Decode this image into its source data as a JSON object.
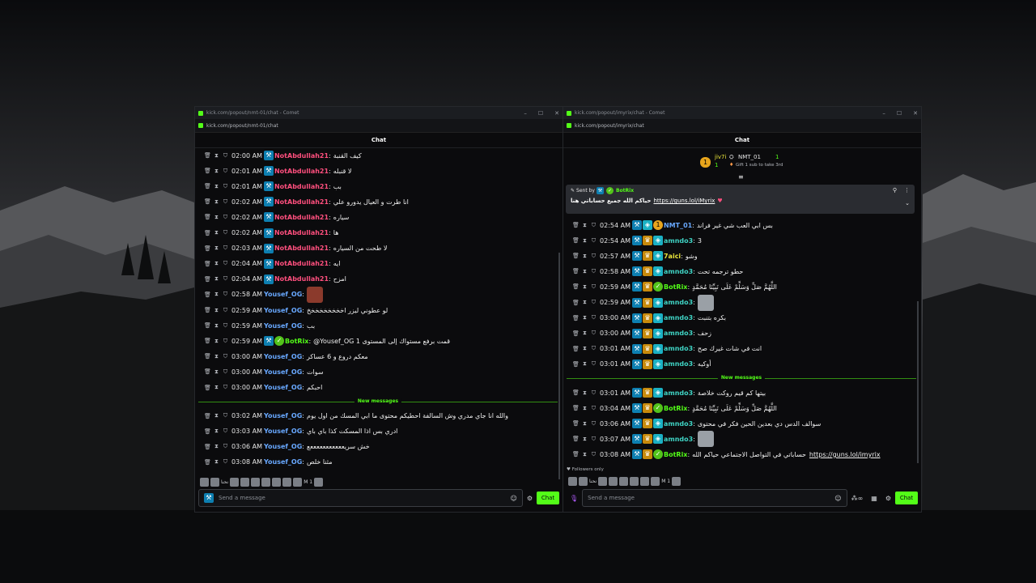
{
  "left_window": {
    "tab_url": "kick.com/popout/nmt-01/chat - Comet",
    "address": "kick.com/popout/nmt-01/chat",
    "header": "Chat",
    "messages": [
      {
        "time": "02:00 AM",
        "user": "NotAbdullah21",
        "color": "pink",
        "badges": [
          "mod"
        ],
        "text": "كيف القنبة"
      },
      {
        "time": "02:01 AM",
        "user": "NotAbdullah21",
        "color": "pink",
        "badges": [
          "mod"
        ],
        "text": "لا قنبله"
      },
      {
        "time": "02:01 AM",
        "user": "NotAbdullah21",
        "color": "pink",
        "badges": [
          "mod"
        ],
        "text": "بب"
      },
      {
        "time": "02:02 AM",
        "user": "NotAbdullah21",
        "color": "pink",
        "badges": [
          "mod"
        ],
        "text": "انا طرت و العيال يدورو علي"
      },
      {
        "time": "02:02 AM",
        "user": "NotAbdullah21",
        "color": "pink",
        "badges": [
          "mod"
        ],
        "text": "سياره"
      },
      {
        "time": "02:02 AM",
        "user": "NotAbdullah21",
        "color": "pink",
        "badges": [
          "mod"
        ],
        "text": "ها"
      },
      {
        "time": "02:03 AM",
        "user": "NotAbdullah21",
        "color": "pink",
        "badges": [
          "mod"
        ],
        "text": "لا طحت من السياره"
      },
      {
        "time": "02:04 AM",
        "user": "NotAbdullah21",
        "color": "pink",
        "badges": [
          "mod"
        ],
        "text": "ايه"
      },
      {
        "time": "02:04 AM",
        "user": "NotAbdullah21",
        "color": "pink",
        "badges": [
          "mod"
        ],
        "text": "امزح"
      },
      {
        "time": "02:58 AM",
        "user": "Yousef_OG",
        "color": "blue",
        "badges": [],
        "text": "",
        "emote": true
      },
      {
        "time": "02:59 AM",
        "user": "Yousef_OG",
        "color": "blue",
        "badges": [],
        "text": "لو عطوني ليزر اخخخخخخخخخ"
      },
      {
        "time": "02:59 AM",
        "user": "Yousef_OG",
        "color": "blue",
        "badges": [],
        "text": "بب"
      },
      {
        "time": "02:59 AM",
        "user": "BotRix",
        "color": "green",
        "badges": [
          "mod",
          "verify"
        ],
        "text": "@Yousef_OG 1 قمت برفع مستواك إلى المستوى"
      },
      {
        "time": "03:00 AM",
        "user": "Yousef_OG",
        "color": "blue",
        "badges": [],
        "text": "معكم دروع و 6 عساكر"
      },
      {
        "time": "03:00 AM",
        "user": "Yousef_OG",
        "color": "blue",
        "badges": [],
        "text": "سوات"
      },
      {
        "time": "03:00 AM",
        "user": "Yousef_OG",
        "color": "blue",
        "badges": [],
        "text": "احبكم"
      }
    ],
    "divider": "New messages",
    "new_messages": [
      {
        "time": "03:02 AM",
        "user": "Yousef_OG",
        "color": "blue",
        "badges": [],
        "text": "والله انا جاي مدري وش السالفة احطيكم محتوى ما ابي المسك من اول يوم"
      },
      {
        "time": "03:03 AM",
        "user": "Yousef_OG",
        "color": "blue",
        "badges": [],
        "text": "ادري بس اذا المسكت كذا باي باي"
      },
      {
        "time": "03:06 AM",
        "user": "Yousef_OG",
        "color": "blue",
        "badges": [],
        "text": "خش سريعععععععععععع"
      },
      {
        "time": "03:08 AM",
        "user": "Yousef_OG",
        "color": "blue",
        "badges": [],
        "text": "مثنا خلص"
      }
    ],
    "reaction_text": "M 1",
    "reaction_label": "نحنا",
    "input_placeholder": "Send a message",
    "chat_button": "Chat"
  },
  "right_window": {
    "tab_url": "kick.com/popout/imyrix/chat - Comet",
    "address": "kick.com/popout/imyrix/chat",
    "header": "Chat",
    "leaderboard": {
      "first_user": "jiv7i",
      "first_count": "1",
      "second_user": "NMT_01",
      "second_count": "1",
      "gift_text": "Gift 1 sub to take 3rd"
    },
    "pinned": {
      "sent_by_label": "Sent by",
      "sender": "BotRix",
      "text": "حياكم الله جميع حساباتي هنا",
      "link": "https://guns.lol/iMyrix"
    },
    "messages": [
      {
        "time": "02:54 AM",
        "user": "NMT_01",
        "color": "blue",
        "badges": [
          "mod",
          "sub",
          "gold"
        ],
        "text": "بس ابي العب شي غير فراند"
      },
      {
        "time": "02:54 AM",
        "user": "amndo3",
        "color": "teal",
        "badges": [
          "mod",
          "crown",
          "sub"
        ],
        "text": "3"
      },
      {
        "time": "02:57 AM",
        "user": "7aici",
        "color": "yellow",
        "badges": [
          "mod",
          "crown",
          "sub"
        ],
        "text": "وشو"
      },
      {
        "time": "02:58 AM",
        "user": "amndo3",
        "color": "teal",
        "badges": [
          "mod",
          "crown",
          "sub"
        ],
        "text": "حطو ترجمه تحت"
      },
      {
        "time": "02:59 AM",
        "user": "BotRix",
        "color": "green",
        "badges": [
          "mod",
          "crown",
          "verify"
        ],
        "text": "اللَّهُمَّ صَلِّ وَسَلِّمْ عَلَى نَبِيِّنَا مُحَمَّدٍ"
      },
      {
        "time": "02:59 AM",
        "user": "amndo3",
        "color": "teal",
        "badges": [
          "mod",
          "crown",
          "sub"
        ],
        "text": "",
        "emote": true
      },
      {
        "time": "03:00 AM",
        "user": "amndo3",
        "color": "teal",
        "badges": [
          "mod",
          "crown",
          "sub"
        ],
        "text": "بكره بتنبت"
      },
      {
        "time": "03:00 AM",
        "user": "amndo3",
        "color": "teal",
        "badges": [
          "mod",
          "crown",
          "sub"
        ],
        "text": "زحف"
      },
      {
        "time": "03:01 AM",
        "user": "amndo3",
        "color": "teal",
        "badges": [
          "mod",
          "crown",
          "sub"
        ],
        "text": "انت في شات غيرك صح"
      },
      {
        "time": "03:01 AM",
        "user": "amndo3",
        "color": "teal",
        "badges": [
          "mod",
          "crown",
          "sub"
        ],
        "text": "أوكيه"
      }
    ],
    "divider": "New messages",
    "new_messages": [
      {
        "time": "03:01 AM",
        "user": "amndo3",
        "color": "teal",
        "badges": [
          "mod",
          "crown",
          "sub"
        ],
        "text": "بيتها كم قيم روكت خلاصة"
      },
      {
        "time": "03:04 AM",
        "user": "BotRix",
        "color": "green",
        "badges": [
          "mod",
          "crown",
          "verify"
        ],
        "text": "اللَّهُمَّ صَلِّ وَسَلِّمْ عَلَى نَبِيِّنَا مُحَمَّدٍ"
      },
      {
        "time": "03:06 AM",
        "user": "amndo3",
        "color": "teal",
        "badges": [
          "mod",
          "crown",
          "sub"
        ],
        "text": "سوالف الدس دي بعدين الحين فكر في محتوى"
      },
      {
        "time": "03:07 AM",
        "user": "amndo3",
        "color": "teal",
        "badges": [
          "mod",
          "crown",
          "sub"
        ],
        "text": "",
        "emote": true
      },
      {
        "time": "03:08 AM",
        "user": "BotRix",
        "color": "green",
        "badges": [
          "mod",
          "crown",
          "verify"
        ],
        "text": "حساباتي في التواصل الاجتماعي حياكم الله",
        "link": "https://guns.lol/imyrix"
      }
    ],
    "followers_only": "Followers only",
    "input_placeholder": "Send a message",
    "chat_button": "Chat"
  }
}
